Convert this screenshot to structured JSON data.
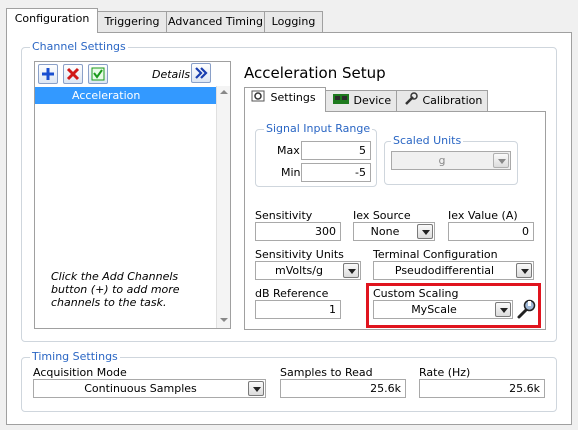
{
  "tabs": [
    "Configuration",
    "Triggering",
    "Advanced Timing",
    "Logging"
  ],
  "channel_settings": {
    "title": "Channel Settings",
    "details_label": "Details",
    "channels": [
      "Acceleration"
    ],
    "hint": "Click the Add Channels button (+) to add more channels to the task."
  },
  "setup": {
    "title": "Acceleration Setup",
    "subtabs": [
      "Settings",
      "Device",
      "Calibration"
    ],
    "signal_input_range": {
      "title": "Signal Input Range",
      "max_label": "Max",
      "max_value": "5",
      "min_label": "Min",
      "min_value": "-5"
    },
    "scaled_units": {
      "title": "Scaled Units",
      "value": "g"
    },
    "sensitivity": {
      "label": "Sensitivity",
      "value": "300"
    },
    "iex_source": {
      "label": "Iex Source",
      "value": "None"
    },
    "iex_value": {
      "label": "Iex Value (A)",
      "value": "0"
    },
    "sensitivity_units": {
      "label": "Sensitivity Units",
      "value": "mVolts/g"
    },
    "terminal_configuration": {
      "label": "Terminal Configuration",
      "value": "Pseudodifferential"
    },
    "db_reference": {
      "label": "dB Reference",
      "value": "1"
    },
    "custom_scaling": {
      "label": "Custom Scaling",
      "value": "MyScale",
      "highlight_color": "#e0141e"
    }
  },
  "timing": {
    "title": "Timing Settings",
    "acquisition_mode": {
      "label": "Acquisition Mode",
      "value": "Continuous Samples"
    },
    "samples_to_read": {
      "label": "Samples to Read",
      "value": "25.6k"
    },
    "rate": {
      "label": "Rate (Hz)",
      "value": "25.6k"
    }
  },
  "colors": {
    "group_title": "#2a66c4",
    "selection": "#3399ff",
    "highlight": "#e0141e"
  }
}
